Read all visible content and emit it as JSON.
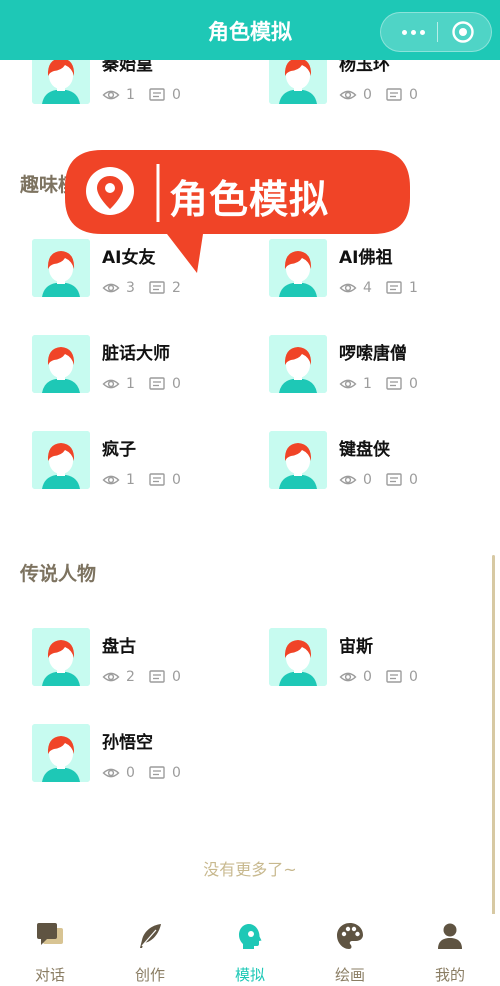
{
  "header": {
    "title": "角色模拟"
  },
  "sections": [
    {
      "title": ""
    },
    {
      "title": "趣味模拟"
    },
    {
      "title": "传说人物"
    }
  ],
  "cards": [
    {
      "name": "秦始皇",
      "views": "1",
      "comments": "0"
    },
    {
      "name": "杨玉环",
      "views": "0",
      "comments": "0"
    },
    {
      "name": "AI女友",
      "views": "3",
      "comments": "2"
    },
    {
      "name": "AI佛祖",
      "views": "4",
      "comments": "1"
    },
    {
      "name": "脏话大师",
      "views": "1",
      "comments": "0"
    },
    {
      "name": "啰嗦唐僧",
      "views": "1",
      "comments": "0"
    },
    {
      "name": "疯子",
      "views": "1",
      "comments": "0"
    },
    {
      "name": "键盘侠",
      "views": "0",
      "comments": "0"
    },
    {
      "name": "盘古",
      "views": "2",
      "comments": "0"
    },
    {
      "name": "宙斯",
      "views": "0",
      "comments": "0"
    },
    {
      "name": "孙悟空",
      "views": "0",
      "comments": "0"
    }
  ],
  "footer_text": "没有更多了~",
  "badge": {
    "text": "角色模拟",
    "icon": "location-pin-icon"
  },
  "tabs": [
    {
      "label": "对话",
      "icon": "chat-bubbles-icon",
      "active": false
    },
    {
      "label": "创作",
      "icon": "feather-icon",
      "active": false
    },
    {
      "label": "模拟",
      "icon": "head-profile-icon",
      "active": true
    },
    {
      "label": "绘画",
      "icon": "palette-icon",
      "active": false
    },
    {
      "label": "我的",
      "icon": "user-icon",
      "active": false
    }
  ],
  "colors": {
    "brand": "#1ec8b6",
    "badge": "#f04427",
    "text_muted": "#9c9c9c",
    "tab_inactive": "#8a7d63",
    "avatar_bg": "#c7fbf0"
  }
}
